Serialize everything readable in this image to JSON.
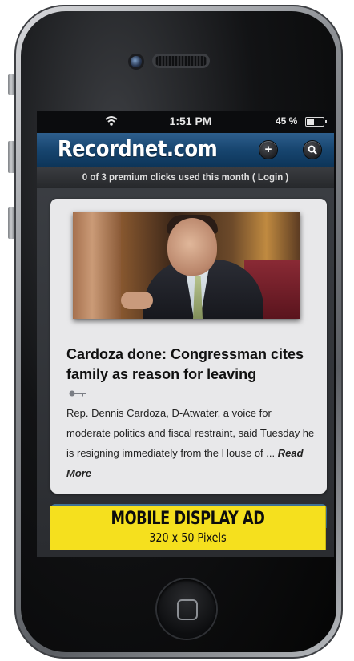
{
  "status_bar": {
    "time": "1:51 PM",
    "battery_text": "45 %",
    "battery_level": 0.45
  },
  "header": {
    "logo": "Recordnet.com",
    "add_icon": "plus-icon",
    "search_icon": "search-icon",
    "brand_color": "#1b4a75"
  },
  "promo_bar": {
    "text": "0 of 3 premium clicks used this month ( Login )"
  },
  "article": {
    "headline": "Cardoza done: Congressman cites family as reason for leaving",
    "summary": "Rep. Dennis Cardoza, D-Atwater, a voice for moderate politics and fiscal restraint, said Tuesday he is resigning immediately from the House of ... ",
    "read_more": "Read More",
    "premium_icon": "key-icon"
  },
  "ad": {
    "title": "MOBILE DISPLAY AD",
    "size": "320 x 50 Pixels",
    "color": "#f5e01e"
  }
}
